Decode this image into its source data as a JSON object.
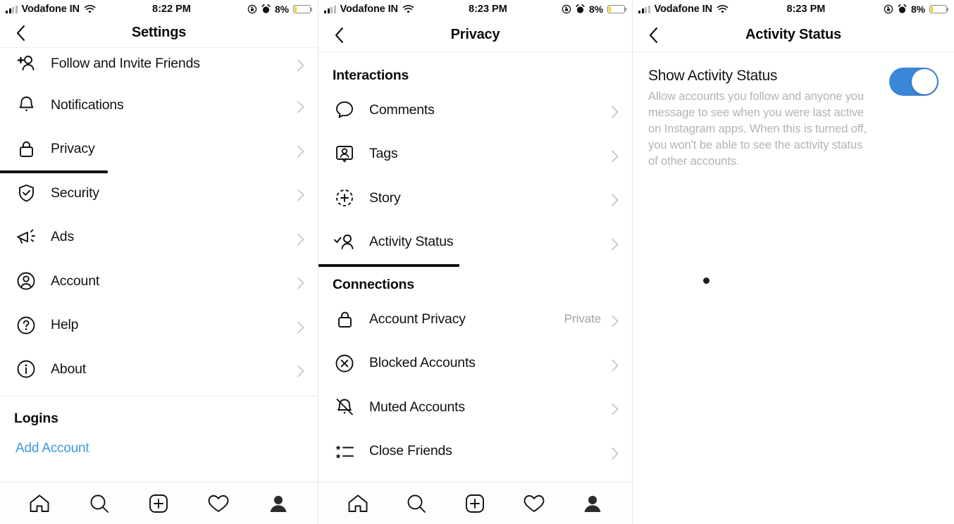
{
  "device": {
    "status_bar": {
      "carrier": "Vodafone IN",
      "signal_icon": "signal-bars-icon",
      "wifi_icon": "wifi-icon",
      "time_settings": "8:22 PM",
      "time_privacy": "8:23 PM",
      "time_activity": "8:23 PM",
      "rotation_lock_icon": "rotation-lock-icon",
      "alarm_icon": "alarm-clock-icon",
      "battery_percent": "8%",
      "battery_icon": "battery-low-icon",
      "battery_fill_color": "#f5d100"
    },
    "tab_bar": {
      "home": "home-icon",
      "search": "search-icon",
      "add": "add-post-icon",
      "activity": "heart-icon",
      "profile": "profile-icon"
    }
  },
  "panel_settings": {
    "title": "Settings",
    "back_icon": "chevron-left-icon",
    "items": [
      {
        "label": "Follow and Invite Friends",
        "icon": "add-person-icon",
        "chevron": "chevron-right-icon",
        "value": ""
      },
      {
        "label": "Notifications",
        "icon": "bell-icon",
        "chevron": "chevron-right-icon",
        "value": ""
      },
      {
        "label": "Privacy",
        "icon": "lock-icon",
        "chevron": "chevron-right-icon",
        "value": "",
        "highlighted": true
      },
      {
        "label": "Security",
        "icon": "shield-check-icon",
        "chevron": "chevron-right-icon",
        "value": ""
      },
      {
        "label": "Ads",
        "icon": "megaphone-icon",
        "chevron": "chevron-right-icon",
        "value": ""
      },
      {
        "label": "Account",
        "icon": "account-circle-icon",
        "chevron": "chevron-right-icon",
        "value": ""
      },
      {
        "label": "Help",
        "icon": "help-circle-icon",
        "chevron": "chevron-right-icon",
        "value": ""
      },
      {
        "label": "About",
        "icon": "info-circle-icon",
        "chevron": "chevron-right-icon",
        "value": ""
      }
    ],
    "logins_header": "Logins",
    "add_account_label": "Add Account",
    "add_account_color": "#3e9ae0"
  },
  "panel_privacy": {
    "title": "Privacy",
    "back_icon": "chevron-left-icon",
    "section_interactions": "Interactions",
    "interactions": [
      {
        "label": "Comments",
        "icon": "comment-bubble-icon",
        "chevron": "chevron-right-icon",
        "value": ""
      },
      {
        "label": "Tags",
        "icon": "tag-person-icon",
        "chevron": "chevron-right-icon",
        "value": ""
      },
      {
        "label": "Story",
        "icon": "story-plus-icon",
        "chevron": "chevron-right-icon",
        "value": ""
      },
      {
        "label": "Activity Status",
        "icon": "activity-person-check-icon",
        "chevron": "chevron-right-icon",
        "value": "",
        "highlighted": true
      }
    ],
    "section_connections": "Connections",
    "connections": [
      {
        "label": "Account Privacy",
        "icon": "lock-icon",
        "chevron": "chevron-right-icon",
        "value": "Private"
      },
      {
        "label": "Blocked Accounts",
        "icon": "block-circle-x-icon",
        "chevron": "chevron-right-icon",
        "value": ""
      },
      {
        "label": "Muted Accounts",
        "icon": "bell-muted-icon",
        "chevron": "chevron-right-icon",
        "value": ""
      },
      {
        "label": "Close Friends",
        "icon": "star-list-icon",
        "chevron": "chevron-right-icon",
        "value": ""
      }
    ]
  },
  "panel_activity_status": {
    "title": "Activity Status",
    "back_icon": "chevron-left-icon",
    "setting_title": "Show Activity Status",
    "setting_description": "Allow accounts you follow and anyone you message to see when you were last active on Instagram apps. When this is turned off, you won't be able to see the activity status of other accounts.",
    "toggle_state": "on",
    "toggle_color": "#3a86d8"
  }
}
